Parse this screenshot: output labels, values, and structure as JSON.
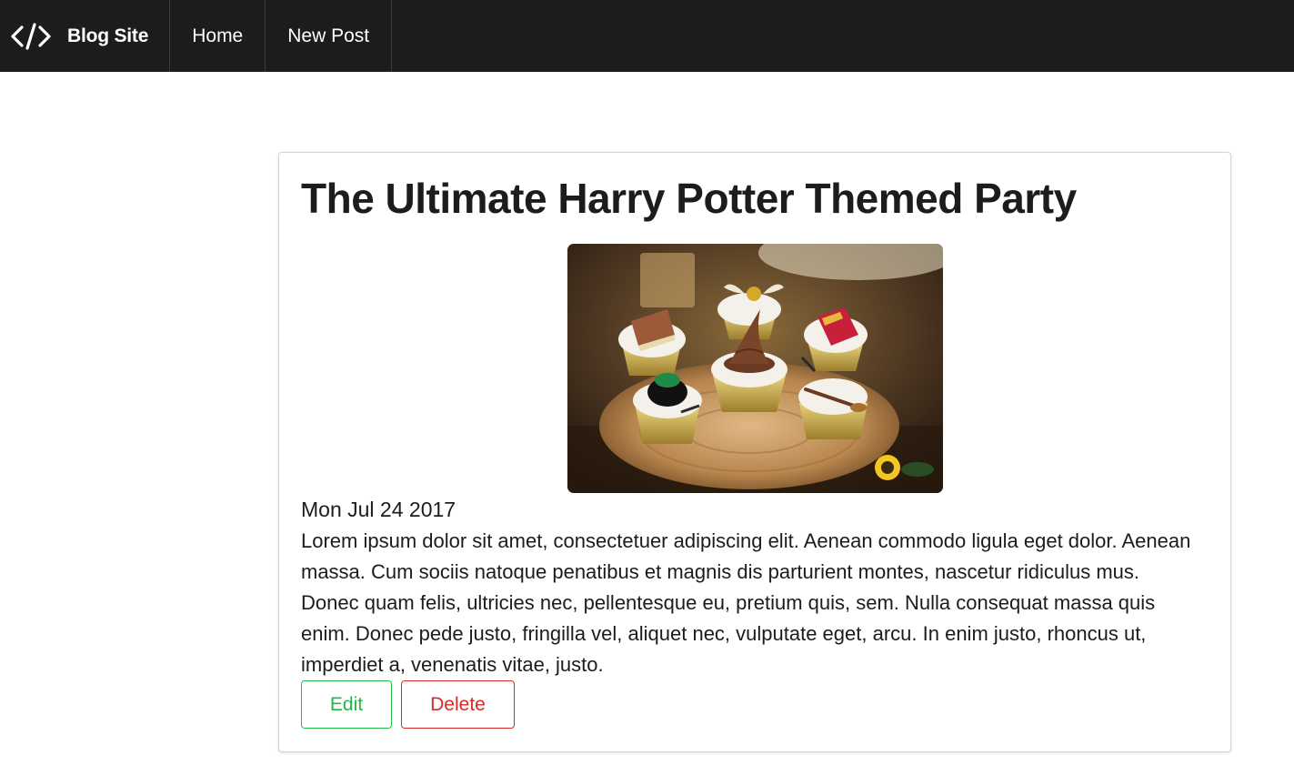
{
  "navbar": {
    "brand_icon": "code-icon",
    "brand_label": "Blog Site",
    "items": [
      {
        "label": "Home"
      },
      {
        "label": "New Post"
      }
    ]
  },
  "post": {
    "title": "The Ultimate Harry Potter Themed Party",
    "image_subject": "harry-potter-cupcakes-photo",
    "date": "Mon Jul 24 2017",
    "body": "Lorem ipsum dolor sit amet, consectetuer adipiscing elit. Aenean commodo ligula eget dolor. Aenean massa. Cum sociis natoque penatibus et magnis dis parturient montes, nascetur ridiculus mus. Donec quam felis, ultricies nec, pellentesque eu, pretium quis, sem. Nulla consequat massa quis enim. Donec pede justo, fringilla vel, aliquet nec, vulputate eget, arcu. In enim justo, rhoncus ut, imperdiet a, venenatis vitae, justo.",
    "edit_label": "Edit",
    "delete_label": "Delete"
  },
  "colors": {
    "navbar_bg": "#1b1c1d",
    "edit": "#21ba45",
    "delete": "#db2828"
  }
}
